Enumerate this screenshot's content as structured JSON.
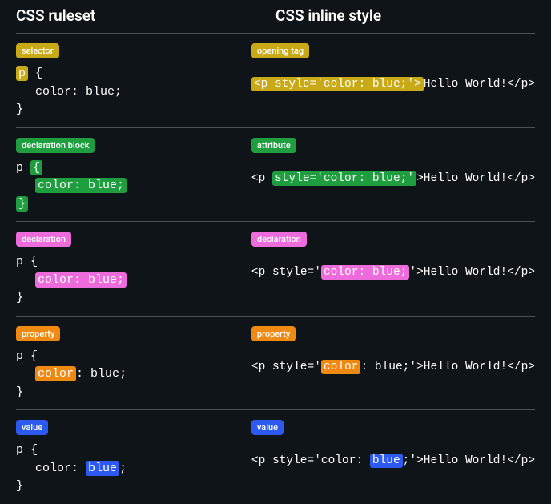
{
  "headers": {
    "left": "CSS ruleset",
    "right": "CSS inline style"
  },
  "colors": {
    "selector": "#c9a916",
    "declaration_block": "#1f9e3f",
    "declaration": "#ee6bdc",
    "property": "#f08911",
    "value": "#2c5af0"
  },
  "labels": {
    "selector": "selector",
    "opening_tag": "opening tag",
    "declaration_block": "declaration block",
    "attribute": "attribute",
    "declaration": "declaration",
    "property": "property",
    "value": "value"
  },
  "ruleset": {
    "selector": "p",
    "open_brace": "{",
    "property": "color",
    "colon": ":",
    "space": " ",
    "val": "blue",
    "semicolon": ";",
    "close_brace": "}",
    "declaration_full": "color: blue;"
  },
  "inline": {
    "lt": "<",
    "tag": "p",
    "attr_prefix": " style='",
    "property": "color",
    "colon": ":",
    "space": " ",
    "val": "blue",
    "semicolon": ";",
    "attr_suffix": "'",
    "gt": ">",
    "content": "Hello World!",
    "close_tag": "</p>",
    "declaration_full": "color: blue;",
    "attr_full": "style='color: blue;'",
    "opening_tag_full": "<p style='color: blue;'>"
  }
}
